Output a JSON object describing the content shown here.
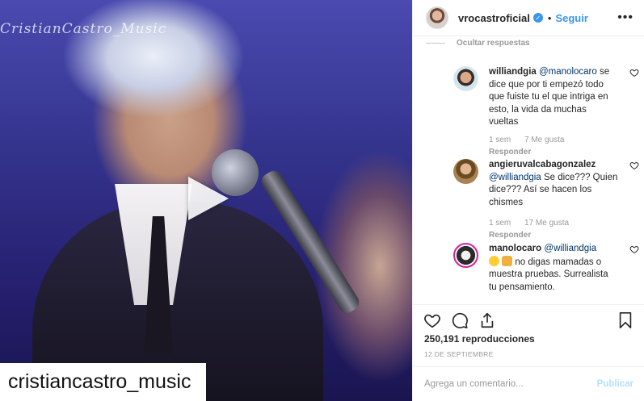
{
  "video": {
    "watermark": "CristianCastro_Music",
    "caption_overlay": "cristiancastro_music"
  },
  "header": {
    "username": "vrocastroficial",
    "separator": "•",
    "follow_label": "Seguir",
    "more_icon": "more-options-icon",
    "verified_icon": "verified-badge-icon"
  },
  "comments": {
    "hide_replies_label": "Ocultar respuestas",
    "items": [
      {
        "user": "williandgia",
        "mention": "@manolocaro",
        "text": "se dice que por ti empezó todo que fuiste tu el que intriga en esto, la vida da muchas vueltas",
        "time": "1 sem",
        "likes": "7 Me gusta",
        "reply_label": "Responder"
      },
      {
        "user": "angieruvalcabagonzalez",
        "mention": "@williandgia",
        "text": "Se dice??? Quien dice??? Así se hacen los chismes",
        "time": "1 sem",
        "likes": "17 Me gusta",
        "reply_label": "Responder"
      },
      {
        "user": "manolocaro",
        "mention": "@williandgia",
        "text": "no digas mamadas o muestra pruebas. Surrealista tu pensamiento.",
        "time": "",
        "likes": "",
        "reply_label": ""
      }
    ]
  },
  "actions": {
    "like_icon": "heart-icon",
    "comment_icon": "comment-icon",
    "share_icon": "share-icon",
    "save_icon": "bookmark-icon"
  },
  "views": "250,191 reproducciones",
  "date": "12 DE SEPTIEMBRE",
  "add_comment": {
    "placeholder": "Agrega un comentario...",
    "publish_label": "Publicar"
  },
  "colors": {
    "accent": "#3897f0",
    "publish_disabled": "#b2dffc",
    "muted": "#999999"
  }
}
